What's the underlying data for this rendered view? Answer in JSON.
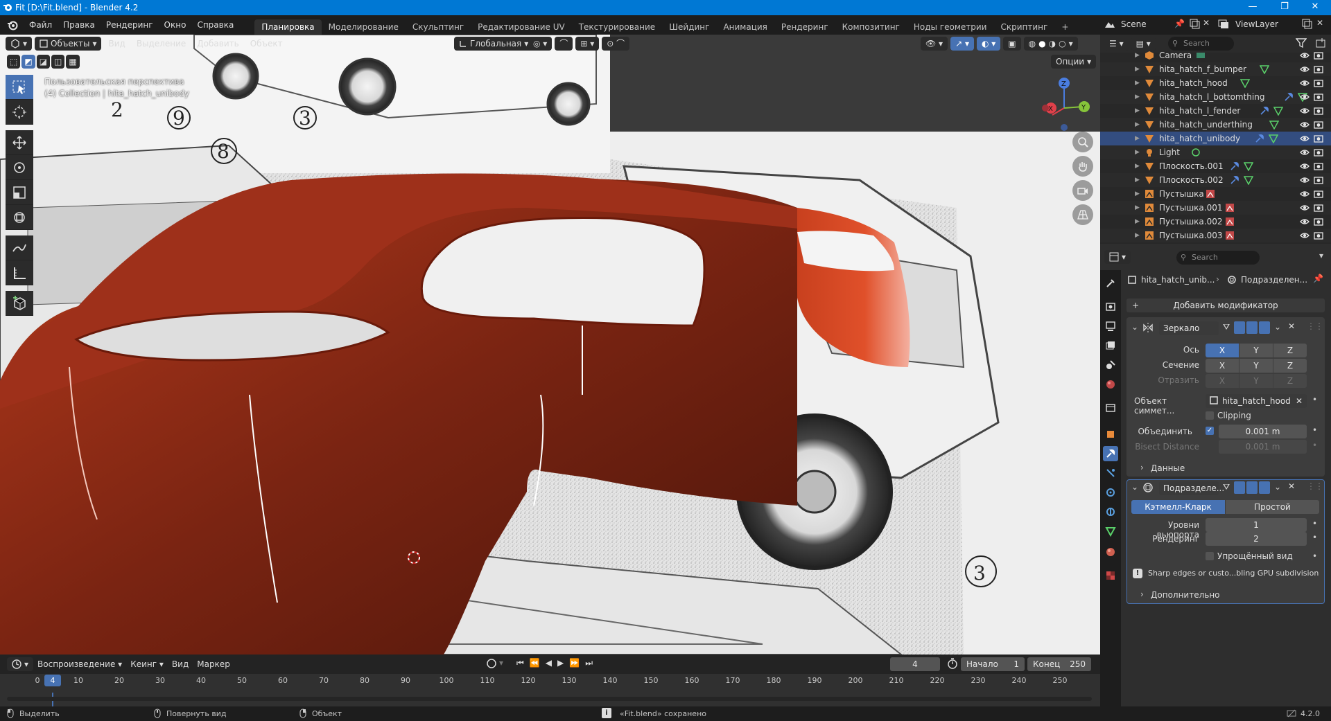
{
  "window": {
    "title": "Fit [D:\\Fit.blend] - Blender 4.2",
    "minimize": "—",
    "maximize": "❐",
    "close": "✕"
  },
  "menu": [
    "Файл",
    "Правка",
    "Рендеринг",
    "Окно",
    "Справка"
  ],
  "workspaces": [
    "Планировка",
    "Моделирование",
    "Скульптинг",
    "Редактирование UV",
    "Текстурирование",
    "Шейдинг",
    "Анимация",
    "Рендеринг",
    "Композитинг",
    "Ноды геометрии",
    "Скриптинг"
  ],
  "active_workspace": "Планировка",
  "scene": {
    "name": "Scene",
    "view_layer": "ViewLayer"
  },
  "viewport": {
    "mode": "Объекты",
    "menus": [
      "Вид",
      "Выделение",
      "Добавить",
      "Объект"
    ],
    "orientation": "Глобальная",
    "options": "Опции",
    "info_line1": "Пользовательская перспектива",
    "info_line2": "(4) Collection | hita_hatch_unibody",
    "gizmo_axes": {
      "x": "X",
      "y": "Y",
      "z": "Z"
    },
    "annotations": [
      "8",
      "9",
      "2",
      "3",
      "3"
    ]
  },
  "outliner": {
    "search_placeholder": "Search",
    "items": [
      {
        "name": "Camera",
        "type": "camera"
      },
      {
        "name": "hita_hatch_f_bumper",
        "type": "mesh"
      },
      {
        "name": "hita_hatch_hood",
        "type": "mesh"
      },
      {
        "name": "hita_hatch_l_bottomthing",
        "type": "mesh"
      },
      {
        "name": "hita_hatch_l_fender",
        "type": "mesh"
      },
      {
        "name": "hita_hatch_underthing",
        "type": "mesh"
      },
      {
        "name": "hita_hatch_unibody",
        "type": "mesh"
      },
      {
        "name": "Light",
        "type": "light"
      },
      {
        "name": "Плоскость.001",
        "type": "mesh"
      },
      {
        "name": "Плоскость.002",
        "type": "mesh"
      },
      {
        "name": "Пустышка",
        "type": "empty"
      },
      {
        "name": "Пустышка.001",
        "type": "empty"
      },
      {
        "name": "Пустышка.002",
        "type": "empty"
      },
      {
        "name": "Пустышка.003",
        "type": "empty"
      }
    ]
  },
  "properties": {
    "search_placeholder": "Search",
    "breadcrumb_object": "hita_hatch_unib...",
    "breadcrumb_modifier": "Подразделен...",
    "add_modifier": "Добавить модификатор",
    "mirror": {
      "name": "Зеркало",
      "axis_label": "Ось",
      "bisect_label": "Сечение",
      "flip_label": "Отразить",
      "axes": [
        "X",
        "Y",
        "Z"
      ],
      "mirror_object_label": "Объект симмет...",
      "mirror_object": "hita_hatch_hood",
      "clipping": "Clipping",
      "merge_label": "Объединить",
      "merge_value": "0.001 m",
      "bisect_distance_label": "Bisect Distance",
      "bisect_distance_value": "0.001 m",
      "data_section": "Данные"
    },
    "subsurf": {
      "name": "Подразделе...",
      "catmull": "Кэтмелл-Кларк",
      "simple": "Простой",
      "viewport_levels_label": "Уровни вьюпорта",
      "viewport_levels": "1",
      "render_label": "Рендеринг",
      "render_levels": "2",
      "simplified_label": "Упрощённый вид",
      "warning": "Sharp edges or custo...bling GPU subdivision",
      "advanced": "Дополнительно"
    }
  },
  "timeline": {
    "menus": [
      "Воспроизведение",
      "Кеинг",
      "Вид",
      "Маркер"
    ],
    "current_frame": "4",
    "start_label": "Начало",
    "start": "1",
    "end_label": "Конец",
    "end": "250",
    "ticks": [
      "0",
      "10",
      "20",
      "30",
      "40",
      "50",
      "60",
      "70",
      "80",
      "90",
      "100",
      "110",
      "120",
      "130",
      "140",
      "150",
      "160",
      "170",
      "180",
      "190",
      "200",
      "210",
      "220",
      "230",
      "240",
      "250"
    ]
  },
  "statusbar": {
    "select": "Выделить",
    "rotate": "Повернуть вид",
    "object": "Объект",
    "message": "«Fit.blend» сохранено",
    "version": "4.2.0"
  },
  "colors": {
    "accent": "#4772b3",
    "body_paint": "#8e2a14",
    "titlebar": "#0078d4"
  }
}
